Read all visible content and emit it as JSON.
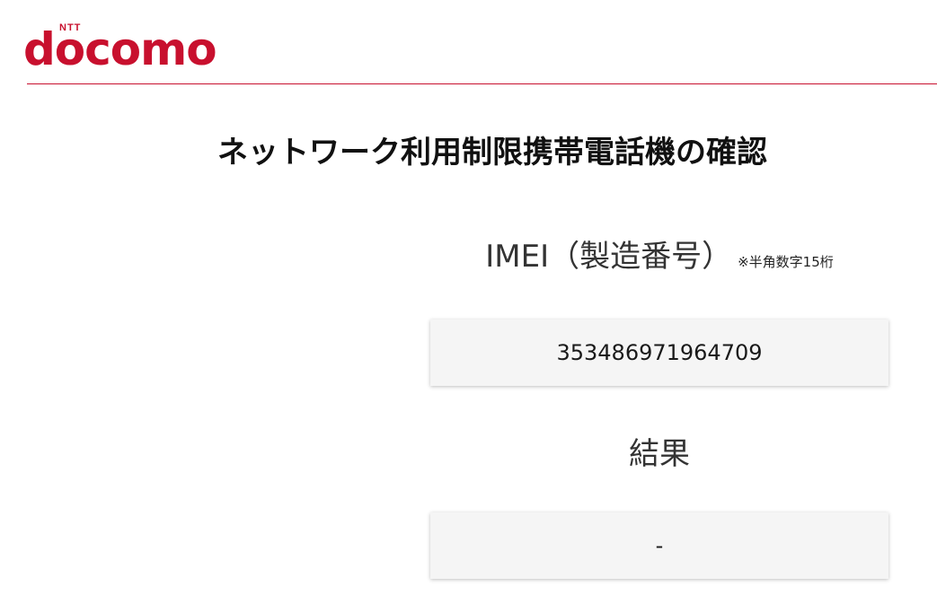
{
  "header": {
    "logo_small": "NTT",
    "logo_word": "docomo",
    "brand_color": "#c8102e"
  },
  "main": {
    "title": "ネットワーク利用制限携帯電話機の確認",
    "imei": {
      "label": "IMEI（製造番号）",
      "note": "※半角数字15桁",
      "value": "353486971964709"
    },
    "result": {
      "label": "結果",
      "value": "-"
    }
  }
}
